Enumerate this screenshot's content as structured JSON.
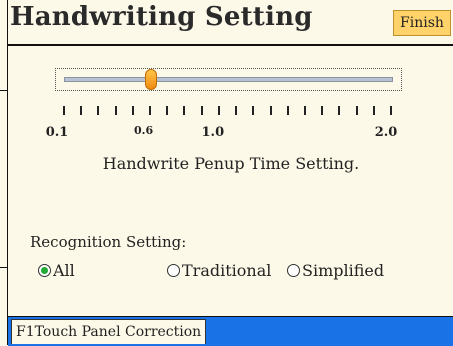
{
  "title": "Handwriting Setting",
  "finish_label": "Finish",
  "penup": {
    "label": "Handwrite Penup Time Setting.",
    "min": 0.1,
    "max": 2.0,
    "value": 0.6,
    "tick_labels": [
      {
        "text": "0.1",
        "value": 0.1,
        "small": false
      },
      {
        "text": "0.6",
        "value": 0.6,
        "small": true
      },
      {
        "text": "1.0",
        "value": 1.0,
        "small": false
      },
      {
        "text": "2.0",
        "value": 2.0,
        "small": false
      }
    ],
    "tick_count": 20
  },
  "recognition": {
    "label": "Recognition Setting:",
    "options": [
      {
        "label": "All",
        "checked": true
      },
      {
        "label": "Traditional",
        "checked": false
      },
      {
        "label": "Simplified",
        "checked": false
      }
    ]
  },
  "bottom": {
    "correction_label": "F1Touch Panel Correction"
  },
  "colors": {
    "background": "#fdf9e8",
    "finish": "#ffd26a",
    "knob": "#f08a10",
    "bottom_bar": "#1a73e6",
    "radio_checked": "#22aa33"
  }
}
